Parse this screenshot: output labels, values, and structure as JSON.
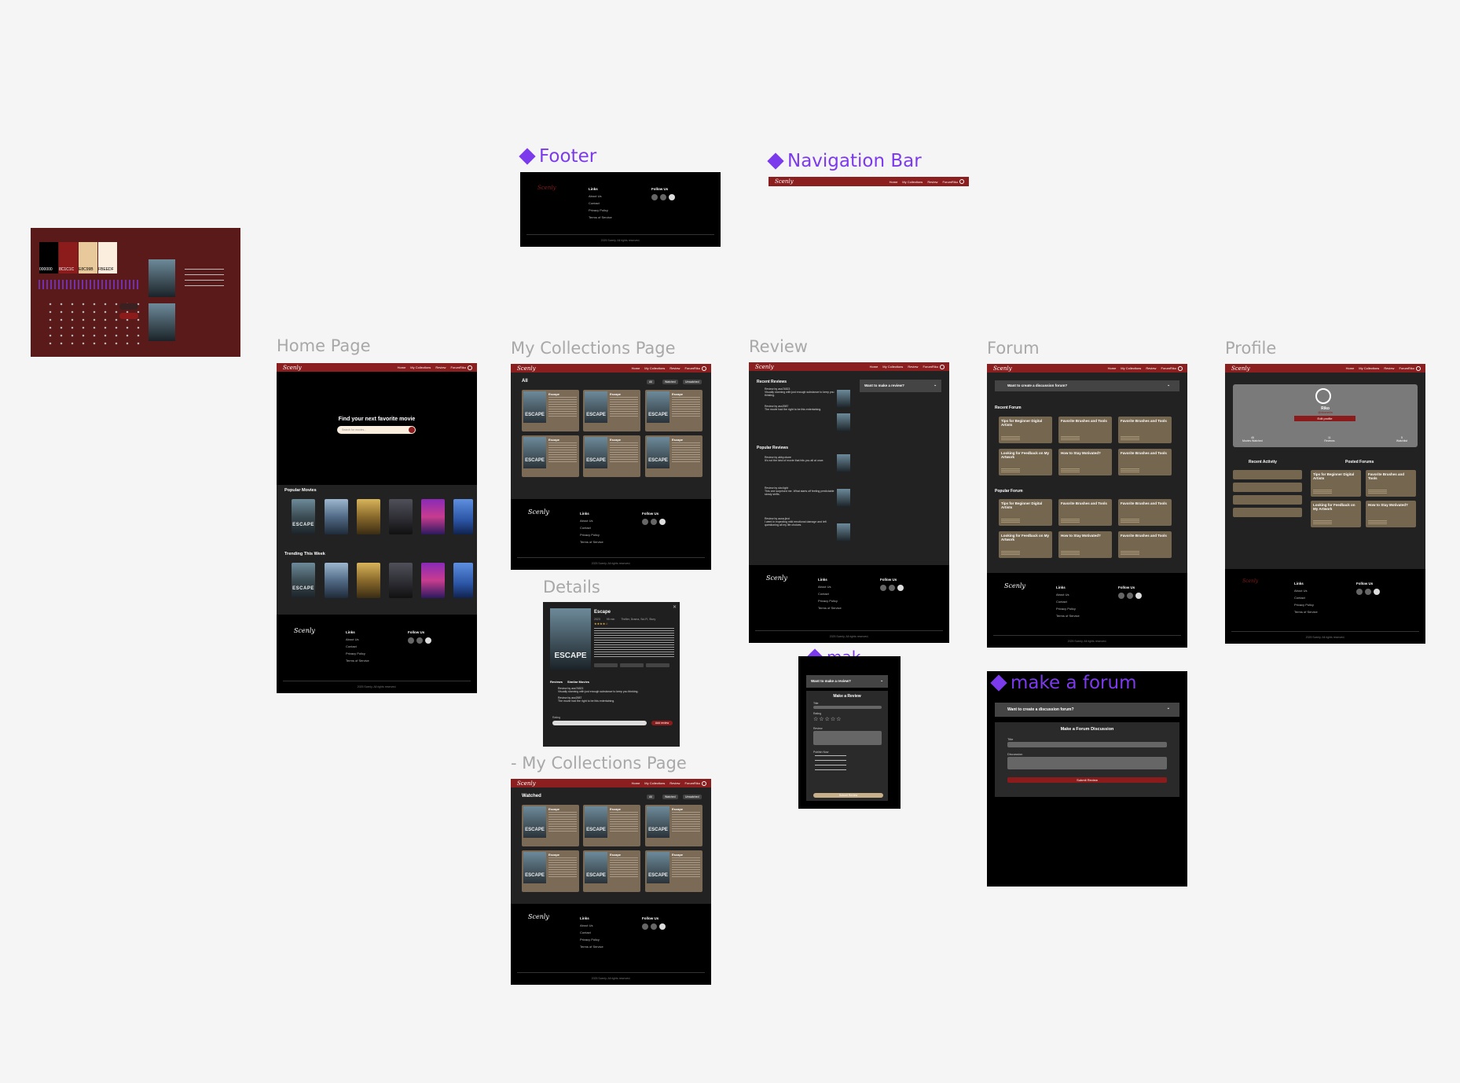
{
  "component_labels": {
    "footer": "Footer",
    "navigation_bar": "Navigation Bar",
    "make_review": "mak...",
    "make_forum": "make a forum"
  },
  "frame_labels": {
    "home": "Home Page",
    "collections": "My Collections Page",
    "review": "Review",
    "forum": "Forum",
    "profile": "Profile",
    "details": "Details",
    "collections_watched": "- My Collections Page"
  },
  "brand": {
    "logo": "Scenly",
    "colors": [
      "#000000",
      "#8C1C1C",
      "#E8C99B",
      "#FBEEDF"
    ],
    "swatch_labels": [
      "000000",
      "8C1C1C",
      "E8C99B",
      "FBEEDF"
    ]
  },
  "nav": {
    "links": [
      "Home",
      "My Collections",
      "Review",
      "Forum"
    ],
    "user": "Riko"
  },
  "footer": {
    "links_title": "Links",
    "links": [
      "About Us",
      "Contact",
      "Privacy Policy",
      "Terms of Service"
    ],
    "follow_title": "Follow Us",
    "icons": [
      "facebook-icon",
      "instagram-icon",
      "x-icon"
    ],
    "copyright": "2025 Scenly. All rights reserved."
  },
  "home": {
    "hero_title": "Find your next favorite movie",
    "search_placeholder": "Search for movies...",
    "popular_title": "Popular Movies",
    "trending_title": "Trending This Week",
    "poster_text": "ESCAPE"
  },
  "collections": {
    "heading": "All",
    "heading_watched": "Watched",
    "filters": [
      "All",
      "Watched",
      "Unwatched"
    ],
    "card_title": "Escape"
  },
  "details": {
    "title": "Escape",
    "meta": [
      "2023",
      "95 min",
      "Thriller, Drama, Sci-Fi, Story"
    ],
    "tabs": [
      "Reviews",
      "Similar Movies"
    ],
    "reviews": [
      {
        "author": "Review by ass74823",
        "text": "Visually stunning with just enough substance to keep you thinking."
      },
      {
        "author": "Review by asx2987",
        "text": "The movie had the right to be this entertaining."
      }
    ],
    "rating_label": "Rating",
    "submit": "Add review"
  },
  "review": {
    "recent_title": "Recent Reviews",
    "popular_title": "Popular Reviews",
    "make_review": "Want to make a review?",
    "recent": [
      {
        "author": "Review by ass74823",
        "text": "Visually stunning with just enough substance to keep you thinking."
      },
      {
        "author": "Review by asx2987",
        "text": "The movie had the right to be this entertaining."
      }
    ],
    "popular": [
      {
        "author": "Review by abby.xtuee",
        "text": "It's not the kind of movie that hits you all at once."
      },
      {
        "author": "Review by stxr.light",
        "text": "This one surprised me. What starts off feeling predictable slowly shifts."
      },
      {
        "author": "Review by auna.jinxi",
        "text": "I went in expecting mild emotional damage and left questioning all my life choices."
      }
    ]
  },
  "forum": {
    "create": "Want to create a discussion forum?",
    "recent_title": "Recent Forum",
    "popular_title": "Popular Forum",
    "cards": [
      "Tips for Beginner Digital Artists",
      "Favorite Brushes and Tools",
      "Favorite Brushes and Tools",
      "Looking for Feedback on My Artwork",
      "How to Stay Motivated?",
      "Favorite Brushes and Tools"
    ]
  },
  "profile": {
    "name": "Riko",
    "handle": "@rikomeilia",
    "edit": "Edit profile",
    "stats": [
      {
        "value": "45",
        "label": "Movies Watched"
      },
      {
        "value": "11",
        "label": "Reviews"
      },
      {
        "value": "5",
        "label": "Watchlist"
      }
    ],
    "recent_activity": "Recent Activity",
    "posted_forums": "Posted Forums",
    "posted": [
      "Tips for Beginner Digital Artists",
      "Favorite Brushes and Tools",
      "Looking for Feedback on My Artwork",
      "How to Stay Motivated?"
    ]
  },
  "make_review_form": {
    "header": "Want to make a review?",
    "title": "Make a Review",
    "fields": [
      "Title",
      "Rating",
      "Review",
      "Publish Now"
    ],
    "submit": "Submit Review"
  },
  "make_forum_form": {
    "header": "Want to create a discussion forum?",
    "title": "Make a Forum Discussion",
    "fields": [
      "Title",
      "Discussion"
    ],
    "submit": "Submit Review"
  }
}
